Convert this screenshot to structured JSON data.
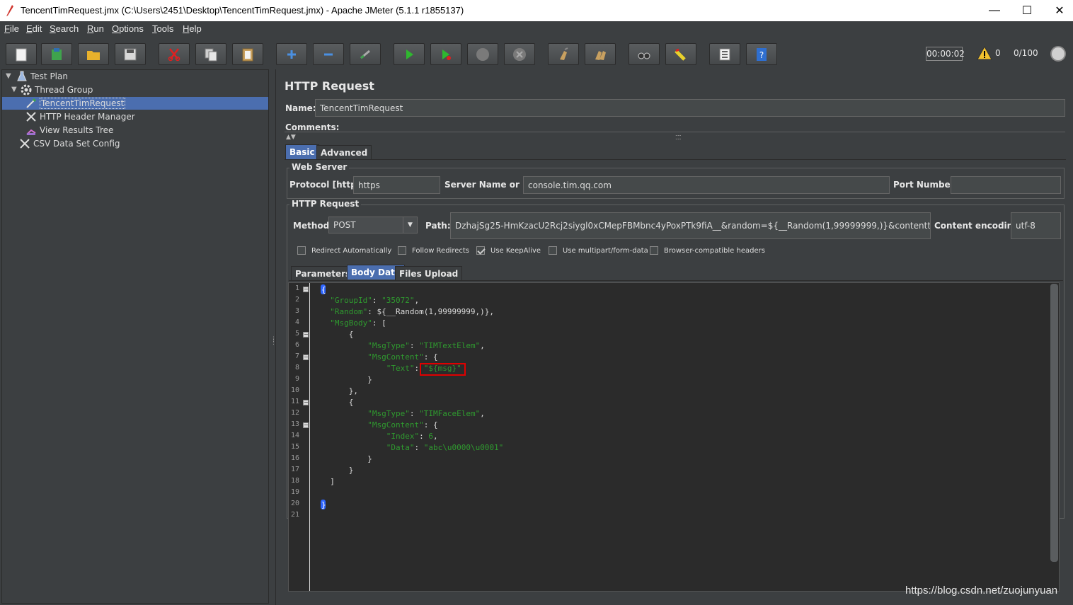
{
  "window": {
    "title": "TencentTimRequest.jmx (C:\\Users\\2451\\Desktop\\TencentTimRequest.jmx) - Apache JMeter (5.1.1 r1855137)",
    "minimize": "—",
    "maximize": "☐",
    "close": "✕"
  },
  "menu": [
    "File",
    "Edit",
    "Search",
    "Run",
    "Options",
    "Tools",
    "Help"
  ],
  "toolbar": {
    "timer": "00:00:02",
    "warning_count": "0",
    "threads": "0/100"
  },
  "tree": [
    {
      "label": "Test Plan"
    },
    {
      "label": "Thread Group"
    },
    {
      "label": "TencentTimRequest"
    },
    {
      "label": "HTTP Header Manager"
    },
    {
      "label": "View Results Tree"
    },
    {
      "label": "CSV Data Set Config"
    }
  ],
  "panel": {
    "title": "HTTP Request",
    "name_label": "Name:",
    "name_value": "TencentTimRequest",
    "comments_label": "Comments:",
    "tabs": [
      "Basic",
      "Advanced"
    ],
    "web_server": {
      "title": "Web Server",
      "protocol_label": "Protocol [http]:",
      "protocol_value": "https",
      "server_label": "Server Name or IP:",
      "server_value": "console.tim.qq.com",
      "port_label": "Port Number:",
      "port_value": ""
    },
    "http_request": {
      "title": "HTTP Request",
      "method_label": "Method:",
      "method_value": "POST",
      "path_label": "Path:",
      "path_value": "DzhajSg25-HmKzacU2Rcj2siygl0xCMepFBMbnc4yPoxPTk9fiA__&random=${__Random(1,99999999,)}&contenttype=json",
      "encoding_label": "Content encoding:",
      "encoding_value": "utf-8"
    },
    "checkboxes": [
      {
        "label": "Redirect Automatically",
        "checked": false
      },
      {
        "label": "Follow Redirects",
        "checked": false
      },
      {
        "label": "Use KeepAlive",
        "checked": true
      },
      {
        "label": "Use multipart/form-data",
        "checked": false
      },
      {
        "label": "Browser-compatible headers",
        "checked": false
      }
    ],
    "sub_tabs": [
      "Parameters",
      "Body Data",
      "Files Upload"
    ]
  },
  "body": {
    "lines": [
      {
        "n": "1",
        "code": "{"
      },
      {
        "n": "2",
        "code": "  \"GroupId\": \"35072\","
      },
      {
        "n": "3",
        "code": "  \"Random\": ${__Random(1,99999999,)},"
      },
      {
        "n": "4",
        "code": "  \"MsgBody\": ["
      },
      {
        "n": "5",
        "code": "      {"
      },
      {
        "n": "6",
        "code": "          \"MsgType\": \"TIMTextElem\","
      },
      {
        "n": "7",
        "code": "          \"MsgContent\": {"
      },
      {
        "n": "8",
        "code": "              \"Text\": \"${msg}\""
      },
      {
        "n": "9",
        "code": "          }"
      },
      {
        "n": "10",
        "code": "      },"
      },
      {
        "n": "11",
        "code": "      {"
      },
      {
        "n": "12",
        "code": "          \"MsgType\": \"TIMFaceElem\","
      },
      {
        "n": "13",
        "code": "          \"MsgContent\": {"
      },
      {
        "n": "14",
        "code": "              \"Index\": 6,"
      },
      {
        "n": "15",
        "code": "              \"Data\": \"abc\\u0000\\u0001\""
      },
      {
        "n": "16",
        "code": "          }"
      },
      {
        "n": "17",
        "code": "      }"
      },
      {
        "n": "18",
        "code": "  ]"
      },
      {
        "n": "19",
        "code": ""
      },
      {
        "n": "20",
        "code": "}"
      },
      {
        "n": "21",
        "code": ""
      }
    ]
  },
  "watermark": "https://blog.csdn.net/zuojunyuan"
}
